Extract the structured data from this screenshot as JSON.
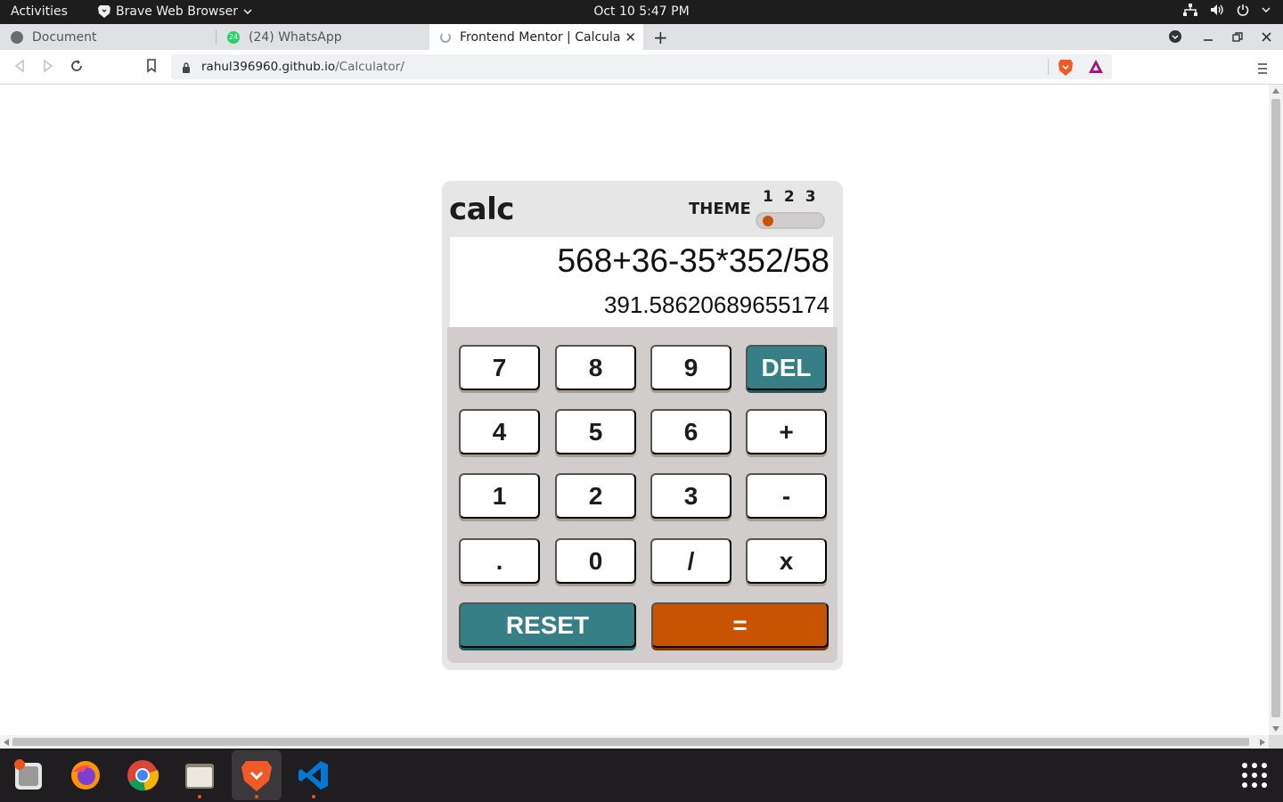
{
  "system_bar": {
    "activities": "Activities",
    "app_name": "Brave Web Browser",
    "clock": "Oct 10  5:47 PM"
  },
  "tabs": [
    {
      "title": "Document",
      "icon": "globe-icon"
    },
    {
      "title": "(24) WhatsApp",
      "icon": "whatsapp-icon",
      "badge": "24"
    },
    {
      "title": "Frontend Mentor | Calcula",
      "icon": "loading-icon",
      "active": true
    }
  ],
  "address_bar": {
    "domain": "rahul396960.github.io",
    "path": "/Calculator/"
  },
  "calculator": {
    "brand": "calc",
    "theme_label": "THEME",
    "theme_options": [
      "1",
      "2",
      "3"
    ],
    "selected_theme": 1,
    "expression": "568+36-35*352/58",
    "result": "391.58620689655174",
    "keys": [
      [
        "7",
        "8",
        "9",
        "DEL"
      ],
      [
        "4",
        "5",
        "6",
        "+"
      ],
      [
        "1",
        "2",
        "3",
        "-"
      ],
      [
        ".",
        "0",
        "/",
        "x"
      ]
    ],
    "reset_label": "RESET",
    "equals_label": "="
  },
  "colors": {
    "accent_teal": "#377f86",
    "accent_orange": "#c85402",
    "keypad_bg": "#d2cdcd",
    "panel_bg": "#e6e6e6"
  },
  "dock": [
    {
      "name": "ubuntu-software"
    },
    {
      "name": "firefox"
    },
    {
      "name": "chrome"
    },
    {
      "name": "files"
    },
    {
      "name": "brave",
      "active": true
    },
    {
      "name": "vscode"
    }
  ]
}
